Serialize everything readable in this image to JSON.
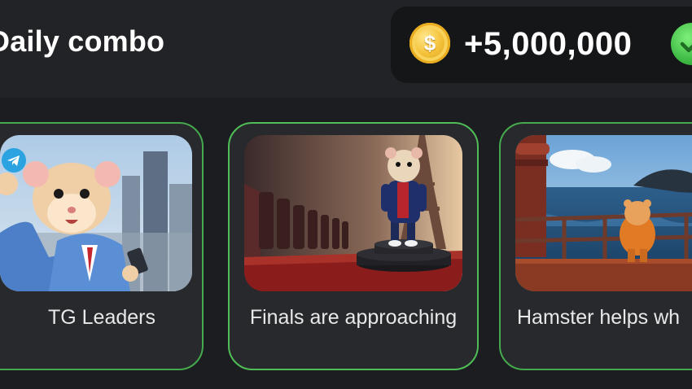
{
  "header": {
    "title": "Daily combo"
  },
  "reward": {
    "coin_symbol": "$",
    "amount": "+5,000,000",
    "status_icon": "check-icon"
  },
  "cards": [
    {
      "label": "TG Leaders",
      "image": "hamster-businessman-with-telegram-logo-and-phone"
    },
    {
      "label": "Finals are approaching",
      "image": "hamster-on-podium-near-eiffel-tower"
    },
    {
      "label": "Hamster helps wh",
      "image": "hamster-on-ship-deck-watching-whale"
    }
  ],
  "colors": {
    "background": "#1c1d20",
    "card_border": "#4fbe57",
    "coin": "#f4c23a",
    "check": "#3fbb45",
    "telegram": "#2aa3e0"
  }
}
